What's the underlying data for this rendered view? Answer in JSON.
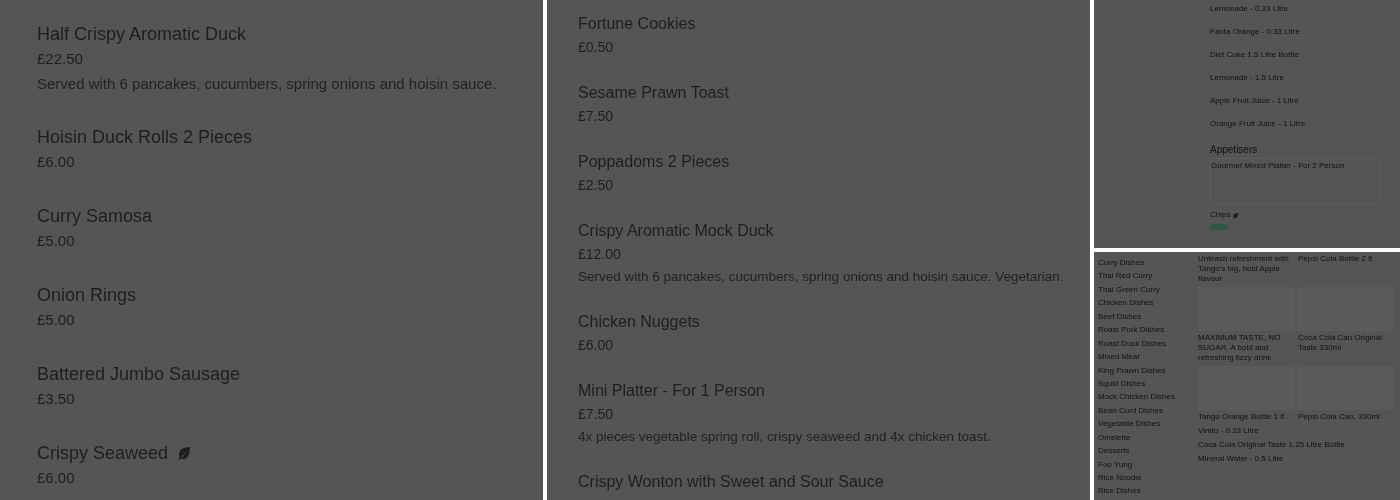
{
  "left_menu": {
    "items": [
      {
        "name": "Half Crispy Aromatic Duck",
        "price": "£22.50",
        "description": "Served with 6 pancakes, cucumbers, spring onions and hoisin sauce.",
        "vegetarian": false
      },
      {
        "name": "Hoisin Duck Rolls 2 Pieces",
        "price": "£6.00",
        "vegetarian": false
      },
      {
        "name": "Curry Samosa",
        "price": "£5.00",
        "vegetarian": false
      },
      {
        "name": "Onion Rings",
        "price": "£5.00",
        "vegetarian": false
      },
      {
        "name": "Battered Jumbo Sausage",
        "price": "£3.50",
        "vegetarian": false
      },
      {
        "name": "Crispy Seaweed",
        "price": "£6.00",
        "vegetarian": true
      }
    ]
  },
  "middle_menu": {
    "items": [
      {
        "name": "Fortune Cookies",
        "price": "£0.50",
        "vegetarian": false
      },
      {
        "name": "Sesame Prawn Toast",
        "price": "£7.50",
        "vegetarian": false
      },
      {
        "name": "Poppadoms 2 Pieces",
        "price": "£2.50",
        "vegetarian": false
      },
      {
        "name": "Crispy Aromatic Mock Duck",
        "price": "£12.00",
        "description": "Served with 6 pancakes, cucumbers, spring onions and hoisin sauce. Vegetarian.",
        "vegetarian": false
      },
      {
        "name": "Chicken Nuggets",
        "price": "£6.00",
        "vegetarian": false
      },
      {
        "name": "Mini Platter - For 1 Person",
        "price": "£7.50",
        "description": "4x pieces vegetable spring roll, crispy seaweed and 4x chicken toast.",
        "vegetarian": false
      },
      {
        "name": "Crispy Wonton with Sweet and Sour Sauce",
        "vegetarian": false
      }
    ]
  },
  "thumbnail_top": {
    "drinks": [
      "Lemonade - 0.33 Litre",
      "Fanta Orange - 0.33 Litre",
      "Diet Coke 1.5 Litre Bottle",
      "Lemonade - 1.5 Litre",
      "Apple Fruit Juice - 1 Litre",
      "Orange Fruit Juice - 1 Litre"
    ],
    "section_title": "Appetisers",
    "featured": "Gourmet Mixed Platter - For 2 Person",
    "last_item": {
      "name": "Chips",
      "vegetarian": true
    }
  },
  "thumbnail_bottom": {
    "categories": [
      "Curry Dishes",
      "Thai Red Curry",
      "Thai Green Curry",
      "Chicken Dishes",
      "Beef Dishes",
      "Roast Pork Dishes",
      "Roast Duck Dishes",
      "Mixed Meat",
      "King Prawn Dishes",
      "Squid Dishes",
      "Mock Chicken Dishes",
      "Bean Curd Dishes",
      "Vegetable Dishes",
      "Omelette",
      "Desserts",
      "Foo Yung",
      "Rice Noodle",
      "Rice Dishes"
    ],
    "grid_rows": [
      {
        "cells": [
          "Unleash refreshment with Tango's big, bold Apple flavour",
          "Pepsi Cola Bottle 2 lt"
        ],
        "images": false
      },
      {
        "cells": [
          "MAXIMUM TASTE, NO SUGAR. A bold and refreshing fizzy drink",
          "Coca Cola Can Original Taste 330ml"
        ],
        "images": true
      },
      {
        "cells": [
          "Tango Orange Bottle 1 lt",
          "Pepsi Cola Can, 330ml"
        ],
        "images": true
      }
    ],
    "list": [
      "Vimto - 0.33 Litre",
      "Coca Cola Original Taste 1.25 Litre Bottle",
      "Mineral Water - 0.5 Litre"
    ]
  }
}
